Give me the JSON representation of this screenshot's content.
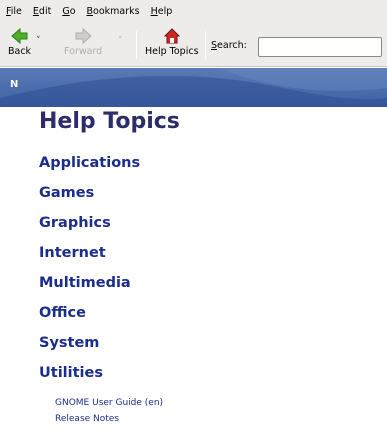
{
  "menubar": {
    "items": [
      {
        "accel": "F",
        "rest": "ile"
      },
      {
        "accel": "E",
        "rest": "dit"
      },
      {
        "accel": "G",
        "rest": "o"
      },
      {
        "accel": "B",
        "rest": "ookmarks"
      },
      {
        "accel": "H",
        "rest": "elp"
      }
    ]
  },
  "toolbar": {
    "back_label": "Back",
    "forward_label": "Forward",
    "help_topics_label": "Help Topics",
    "search_label_accel": "S",
    "search_label_rest": "earch:",
    "search_value": "",
    "dropdown_glyph": "˅",
    "colors": {
      "back_icon": "#4caf2a",
      "home_roof": "#c82828"
    }
  },
  "banner": {
    "letter": "N",
    "colors": {
      "base": "#3e61a3",
      "swoosh": "#2f4f92"
    }
  },
  "main": {
    "title": "Help Topics",
    "categories": [
      "Applications",
      "Games",
      "Graphics",
      "Internet",
      "Multimedia",
      "Office",
      "System",
      "Utilities"
    ],
    "links": [
      "GNOME User Guide (en)",
      "Release Notes"
    ]
  }
}
